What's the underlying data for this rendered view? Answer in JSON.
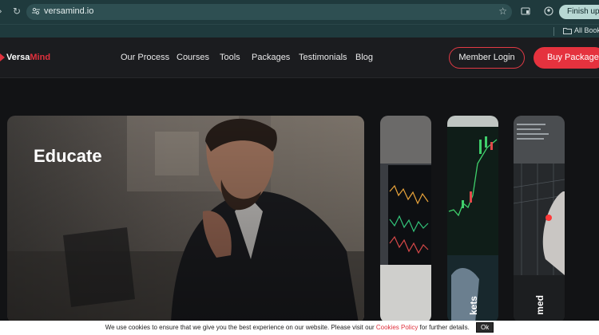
{
  "browser": {
    "url": "versamind.io",
    "update_button": "Finish update",
    "bookmarks_label": "All Bookmarks"
  },
  "header": {
    "logo_part1": "Versa",
    "logo_part2": "Mind",
    "nav": [
      "Our Process",
      "Courses",
      "Tools",
      "Packages",
      "Testimonials",
      "Blog"
    ],
    "member_login": "Member Login",
    "buy_package": "Buy Package",
    "accent_color": "#e5323e"
  },
  "hero": {
    "main_card_title": "Educate",
    "side_card_labels": [
      "kets",
      "med"
    ]
  },
  "cookie": {
    "text_before": "We use cookies to ensure that we give you the best experience on our website. Please visit our ",
    "link": "Cookies Policy",
    "text_after": " for further details.",
    "ok": "Ok"
  }
}
